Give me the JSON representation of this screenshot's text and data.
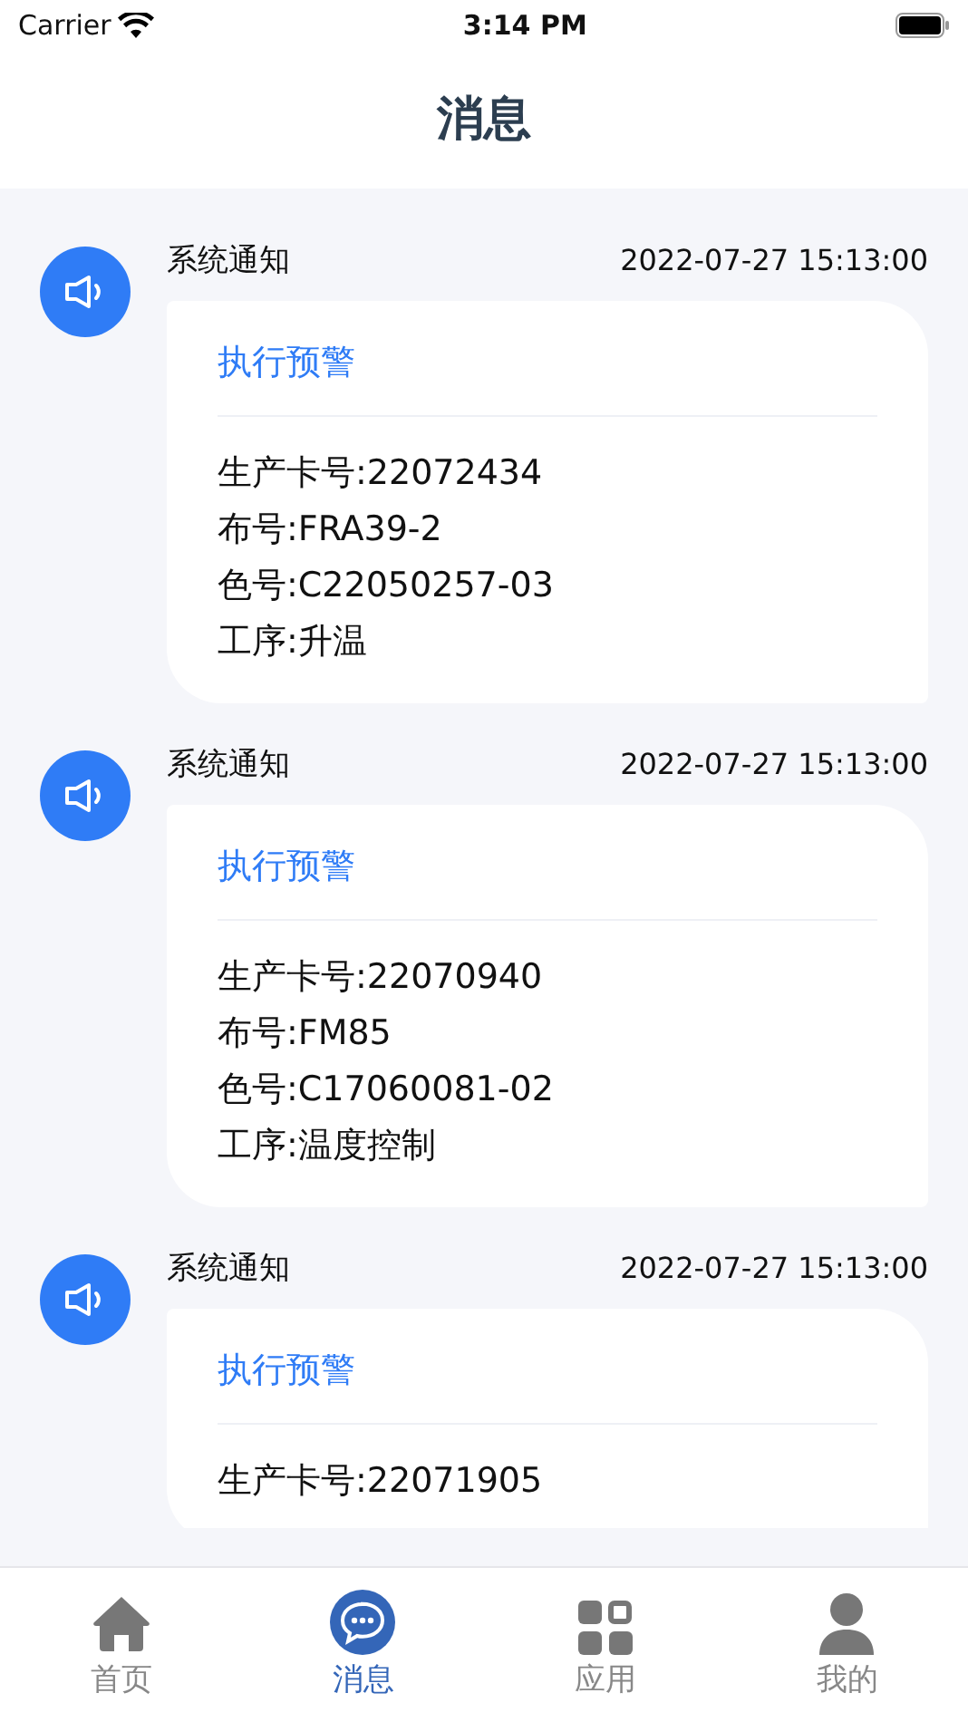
{
  "status_bar": {
    "carrier": "Carrier",
    "time": "3:14 PM"
  },
  "header": {
    "title": "消息"
  },
  "messages": [
    {
      "sender": "系统通知",
      "time": "2022-07-27 15:13:00",
      "title": "执行预警",
      "fields": [
        "生产卡号:22072434",
        "布号:FRA39-2",
        "色号:C22050257-03",
        "工序:升温"
      ]
    },
    {
      "sender": "系统通知",
      "time": "2022-07-27 15:13:00",
      "title": "执行预警",
      "fields": [
        "生产卡号:22070940",
        "布号:FM85",
        "色号:C17060081-02",
        "工序:温度控制"
      ]
    },
    {
      "sender": "系统通知",
      "time": "2022-07-27 15:13:00",
      "title": "执行预警",
      "fields": [
        "生产卡号:22071905"
      ]
    }
  ],
  "tab_bar": [
    {
      "label": "首页",
      "selected": false
    },
    {
      "label": "消息",
      "selected": true
    },
    {
      "label": "应用",
      "selected": false
    },
    {
      "label": "我的",
      "selected": false
    }
  ]
}
